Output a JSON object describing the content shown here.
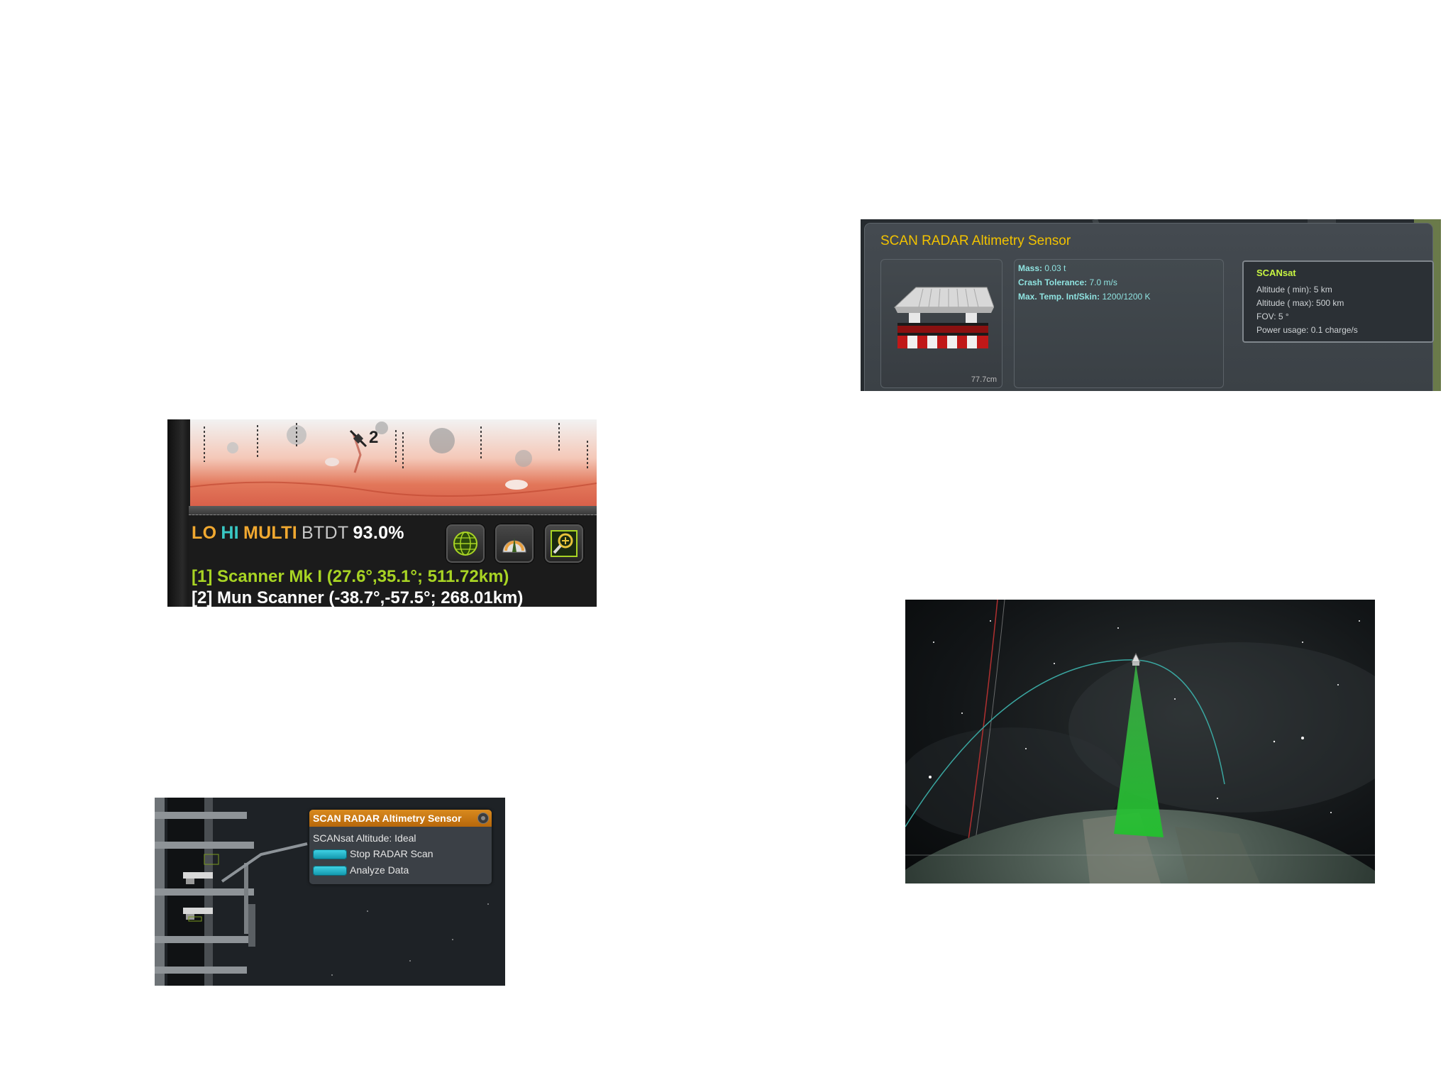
{
  "map_panel": {
    "vessel_marker_number": "2",
    "legend": {
      "lo": "LO",
      "hi": "HI",
      "multi": "MULTI",
      "btdt": "BTDT",
      "percent": "93.0%"
    },
    "vessels": [
      "[1] Scanner Mk I (27.6°,35.1°; 511.72km)",
      "[2] Mun Scanner (-38.7°,-57.5°; 268.01km)"
    ],
    "colors": {
      "lo": "#f0a830",
      "hi": "#39c8c4",
      "multi": "#f0a830",
      "btdt": "#c8c8c8",
      "percent": "#ffffff",
      "vessel_active": "#a8d424",
      "vessel_other": "#ffffff"
    },
    "buttons": [
      "globe-icon",
      "altimeter-icon",
      "zoom-map-icon"
    ]
  },
  "context_menu": {
    "title": "SCAN RADAR Altimetry Sensor",
    "status": "SCANsat Altitude: Ideal",
    "actions": [
      "Stop RADAR Scan",
      "Analyze Data"
    ],
    "colors": {
      "title_bar": "#c8760f",
      "button": "#28b6cc"
    }
  },
  "part_info": {
    "title": "SCAN RADAR Altimetry Sensor",
    "size_label": "77.7cm",
    "stats": [
      {
        "label": "Mass:",
        "value": "0.03 t"
      },
      {
        "label": "Crash Tolerance:",
        "value": "7.0 m/s"
      },
      {
        "label": "Max. Temp. Int/Skin:",
        "value": "1200/1200 K"
      }
    ],
    "module": {
      "name": "SCANsat",
      "lines": [
        "Altitude ( min): 5 km",
        "Altitude ( max): 500 km",
        "FOV: 5 °",
        "Power usage: 0.1 charge/s"
      ]
    },
    "colors": {
      "title": "#f2c200",
      "module_title": "#c8f542",
      "stats": "#8fe3e0"
    }
  }
}
